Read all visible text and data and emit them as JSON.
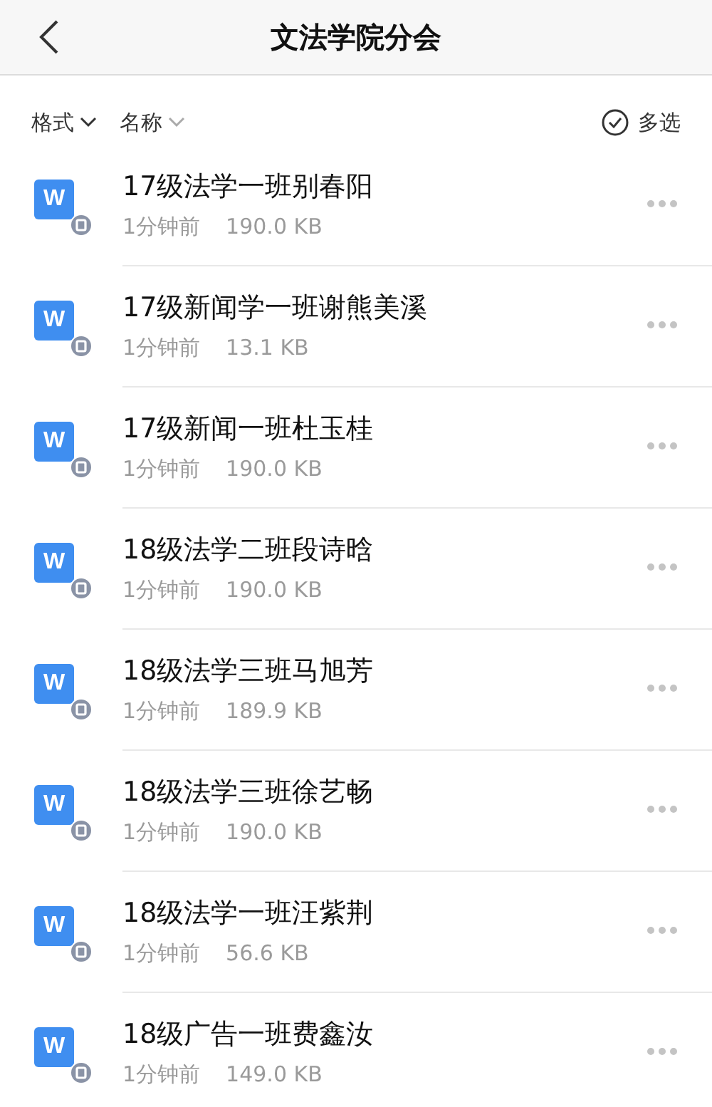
{
  "header": {
    "title": "文法学院分会"
  },
  "toolbar": {
    "filters": [
      {
        "label": "格式",
        "active": true
      },
      {
        "label": "名称",
        "active": false
      }
    ],
    "multiselect": "多选"
  },
  "files": [
    {
      "icon_letter": "W",
      "name": "17级法学一班别春阳",
      "time": "1分钟前",
      "size": "190.0 KB"
    },
    {
      "icon_letter": "W",
      "name": "17级新闻学一班谢熊美溪",
      "time": "1分钟前",
      "size": "13.1 KB"
    },
    {
      "icon_letter": "W",
      "name": "17级新闻一班杜玉桂",
      "time": "1分钟前",
      "size": "190.0 KB"
    },
    {
      "icon_letter": "W",
      "name": "18级法学二班段诗晗",
      "time": "1分钟前",
      "size": "190.0 KB"
    },
    {
      "icon_letter": "W",
      "name": "18级法学三班马旭芳",
      "time": "1分钟前",
      "size": "189.9 KB"
    },
    {
      "icon_letter": "W",
      "name": "18级法学三班徐艺畅",
      "time": "1分钟前",
      "size": "190.0 KB"
    },
    {
      "icon_letter": "W",
      "name": "18级法学一班汪紫荆",
      "time": "1分钟前",
      "size": "56.6 KB"
    },
    {
      "icon_letter": "W",
      "name": "18级广告一班费鑫汝",
      "time": "1分钟前",
      "size": "149.0 KB"
    }
  ]
}
